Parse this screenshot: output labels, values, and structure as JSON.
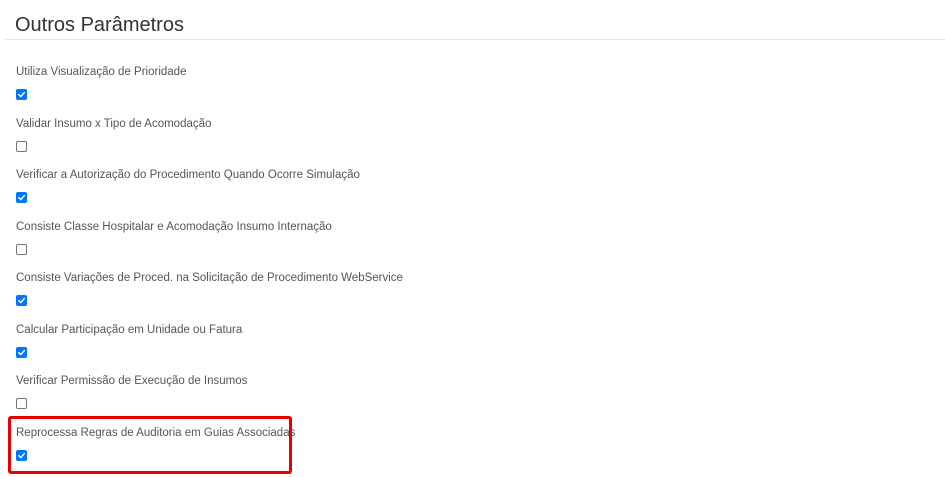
{
  "section": {
    "title": "Outros Parâmetros"
  },
  "params": [
    {
      "label": "Utiliza Visualização de Prioridade",
      "checked": true
    },
    {
      "label": "Validar Insumo x Tipo de Acomodação",
      "checked": false
    },
    {
      "label": "Verificar a Autorização do Procedimento Quando Ocorre Simulação",
      "checked": true
    },
    {
      "label": "Consiste Classe Hospitalar e Acomodação Insumo Internação",
      "checked": false
    },
    {
      "label": "Consiste Variações de Proced. na Solicitação de Procedimento WebService",
      "checked": true
    },
    {
      "label": "Calcular Participação em Unidade ou Fatura",
      "checked": true
    },
    {
      "label": "Verificar Permissão de Execução de Insumos",
      "checked": false
    },
    {
      "label": "Reprocessa Regras de Auditoria em Guias Associadas",
      "checked": true
    }
  ],
  "colors": {
    "checkbox_checked": "#0075ff",
    "highlight": "#e60000"
  },
  "icons": {
    "checked": "checkmark-icon"
  }
}
